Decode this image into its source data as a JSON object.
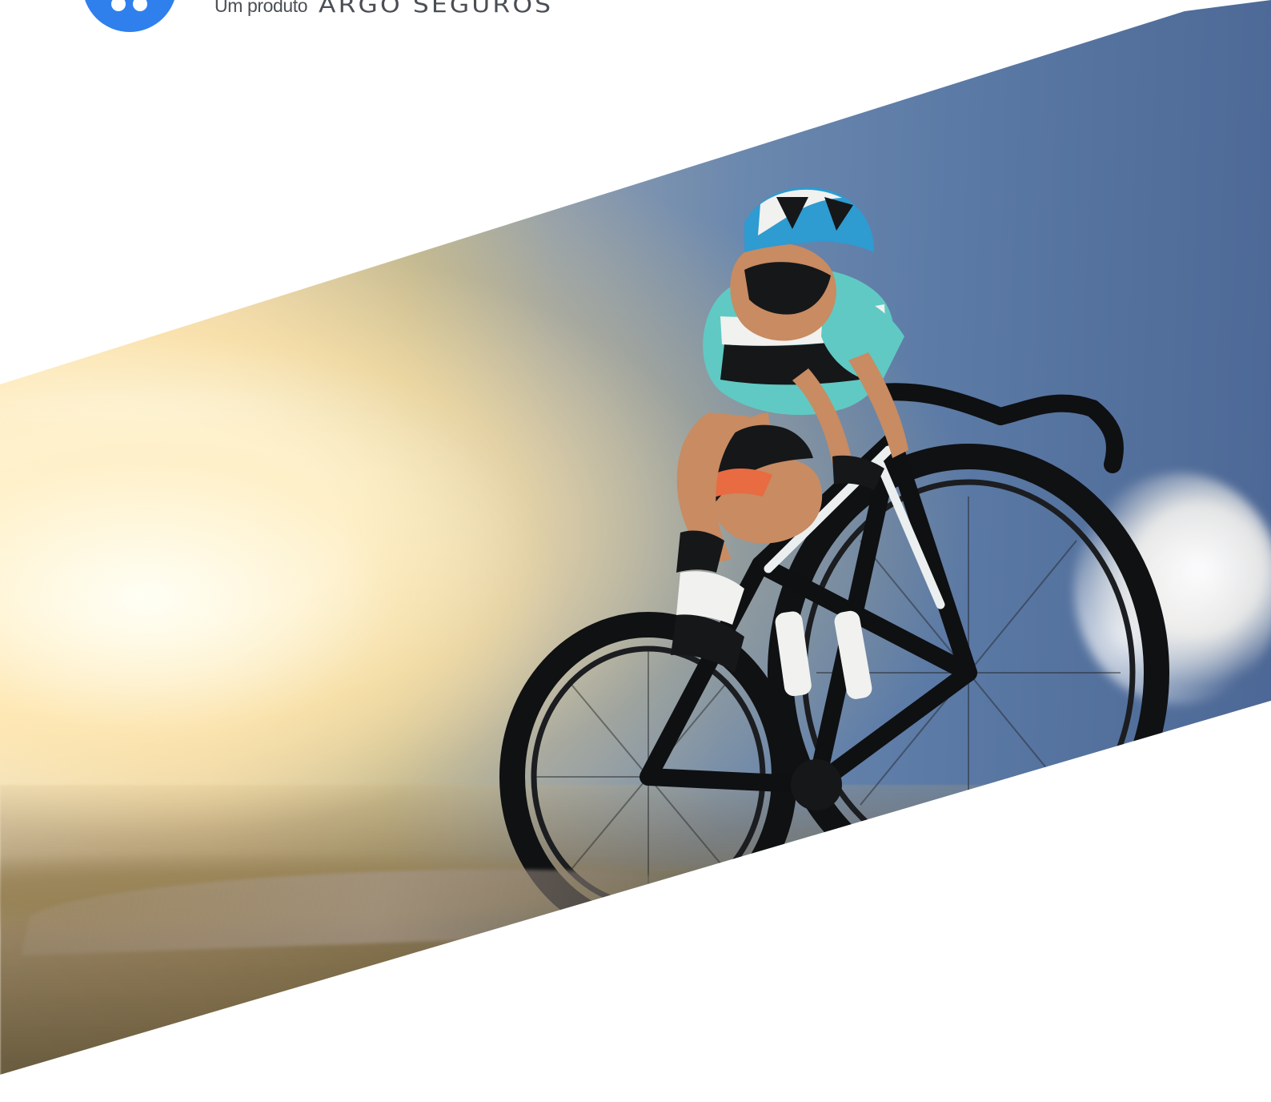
{
  "brand": {
    "prefix": "Um produto",
    "name": "ARGO SEGUROS",
    "accent_color": "#2f80ed",
    "icon": "logo-circle-icon"
  },
  "hero": {
    "image_subject": "cyclist-road-bike",
    "colors": {
      "sky": "#5c7ba6",
      "sunlight": "#fff7de",
      "jersey": "#60c9c3"
    }
  }
}
